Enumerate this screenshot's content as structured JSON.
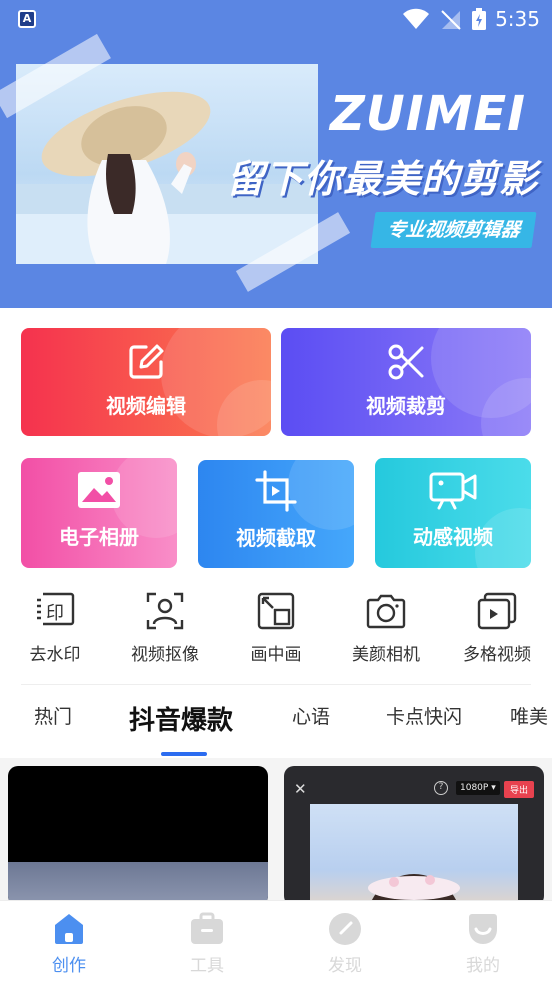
{
  "status_bar": {
    "time": "5:35",
    "badge": "A"
  },
  "banner": {
    "slogan_en": "ZUIMEI",
    "slogan_cn": "留下你最美的剪影",
    "tagline": "专业视频剪辑器",
    "background_color": "#5b86e3"
  },
  "main_actions": [
    {
      "label": "视频编辑",
      "icon": "edit-icon"
    },
    {
      "label": "视频裁剪",
      "icon": "scissors-icon"
    },
    {
      "label": "电子相册",
      "icon": "photo-album-icon"
    },
    {
      "label": "视频截取",
      "icon": "crop-icon"
    },
    {
      "label": "动感视频",
      "icon": "video-camera-icon"
    }
  ],
  "tools": [
    {
      "label": "去水印",
      "icon": "watermark-icon"
    },
    {
      "label": "视频抠像",
      "icon": "portrait-matting-icon"
    },
    {
      "label": "画中画",
      "icon": "picture-in-picture-icon"
    },
    {
      "label": "美颜相机",
      "icon": "beauty-camera-icon"
    },
    {
      "label": "多格视频",
      "icon": "multi-grid-video-icon"
    }
  ],
  "category_tabs": [
    {
      "label": "热门",
      "active": false
    },
    {
      "label": "抖音爆款",
      "active": true
    },
    {
      "label": "心语",
      "active": false
    },
    {
      "label": "卡点快闪",
      "active": false
    },
    {
      "label": "唯美",
      "active": false
    }
  ],
  "preview_card": {
    "close": "✕",
    "help": "?",
    "resolution": "1080P ▾",
    "export": "导出"
  },
  "bottom_nav": [
    {
      "label": "创作",
      "icon": "home-icon",
      "active": true
    },
    {
      "label": "工具",
      "icon": "toolbox-icon",
      "active": false
    },
    {
      "label": "发现",
      "icon": "compass-icon",
      "active": false
    },
    {
      "label": "我的",
      "icon": "profile-icon",
      "active": false
    }
  ],
  "colors": {
    "accent": "#4c8ff0",
    "tab_indicator": "#2b6cf0"
  }
}
